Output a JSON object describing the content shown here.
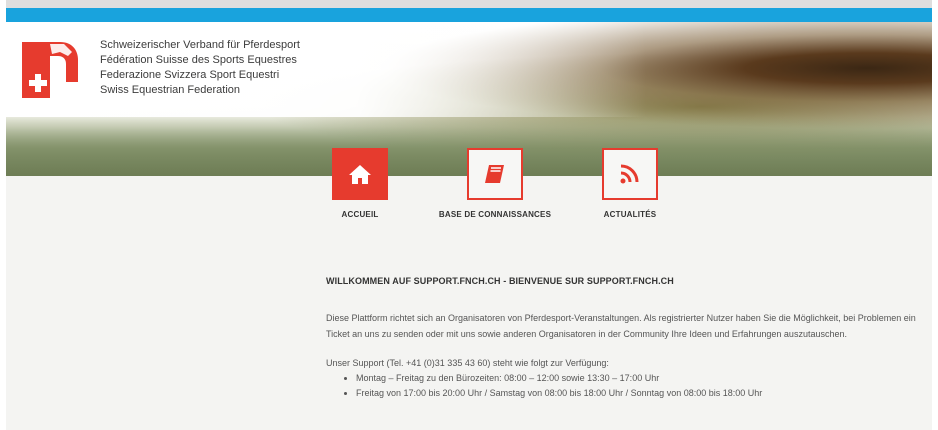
{
  "header": {
    "federation_names": [
      "Schweizerischer Verband für Pferdesport",
      "Fédération Suisse des Sports Equestres",
      "Federazione Svizzera Sport Equestri",
      "Swiss Equestrian Federation"
    ],
    "logo_icon": "fnch-horse-cross-logo"
  },
  "nav": [
    {
      "label": "ACCUEIL",
      "icon": "home-icon",
      "active": true
    },
    {
      "label": "BASE DE CONNAISSANCES",
      "icon": "book-icon",
      "active": false
    },
    {
      "label": "ACTUALITÉS",
      "icon": "rss-icon",
      "active": false
    }
  ],
  "main": {
    "welcome_title": "WILLKOMMEN AUF SUPPORT.FNCH.CH - BIENVENUE SUR SUPPORT.FNCH.CH",
    "intro": "Diese Plattform richtet sich an Organisatoren von Pferdesport-Veranstaltungen. Als registrierter Nutzer haben Sie die Möglichkeit, bei Problemen ein Ticket an uns zu senden oder mit uns sowie anderen Organisatoren in der Community Ihre Ideen und Erfahrungen auszutauschen.",
    "support_heading": "Unser Support (Tel. +41 (0)31 335 43 60) steht wie folgt zur Verfügung:",
    "support_hours": [
      "Montag – Freitag zu den Bürozeiten: 08:00 – 12:00 sowie 13:30 – 17:00 Uhr",
      "Freitag von 17:00 bis 20:00 Uhr / Samstag von 08:00 bis 18:00 Uhr / Sonntag von 08:00 bis 18:00 Uhr"
    ]
  },
  "colors": {
    "accent": "#e63b2e",
    "top_bar": "#19a3dd"
  }
}
